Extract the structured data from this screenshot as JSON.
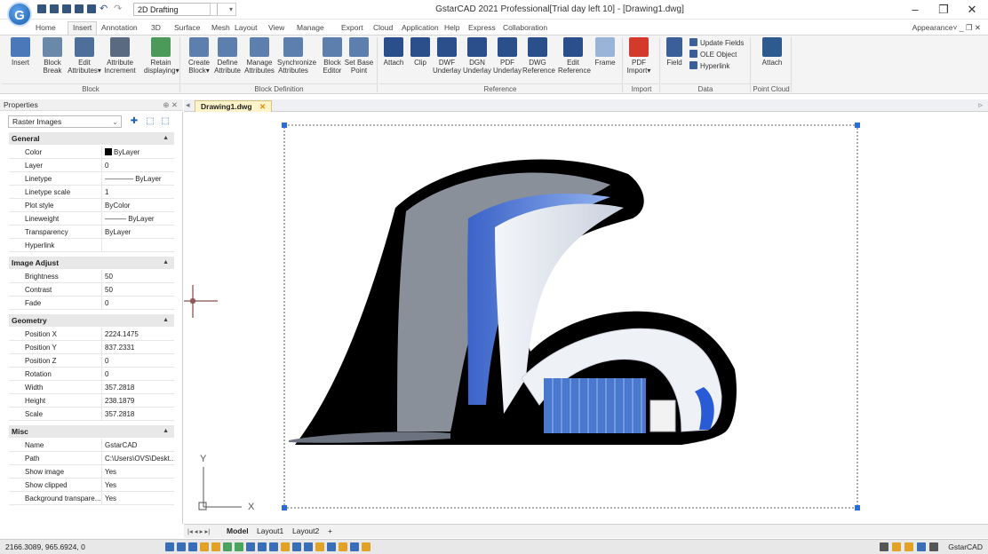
{
  "title_bar": {
    "logo": "G",
    "workspace": "2D Drafting",
    "window_title": "GstarCAD 2021 Professional[Trial day left 10] - [Drawing1.dwg]",
    "controls": [
      "–",
      "❐",
      "✕"
    ]
  },
  "tabs": [
    "Home",
    "Insert",
    "Annotation",
    "3D",
    "Surface",
    "Mesh",
    "Layout",
    "View",
    "Manage",
    "Export",
    "Cloud",
    "Application",
    "Help",
    "Express",
    "Collaboration"
  ],
  "active_tab": "Insert",
  "appearance": "Appearance˅  _ ❐ ✕",
  "ribbon": {
    "block": {
      "label": "Block",
      "buttons": [
        {
          "line1": "Insert",
          "line2": ""
        },
        {
          "line1": "Block",
          "line2": "Break"
        },
        {
          "line1": "Edit",
          "line2": "Attributes▾"
        },
        {
          "line1": "Attribute",
          "line2": "Increment"
        },
        {
          "line1": "Retain",
          "line2": "displaying▾"
        }
      ]
    },
    "block_definition": {
      "label": "Block Definition",
      "buttons": [
        {
          "line1": "Create",
          "line2": "Block▾"
        },
        {
          "line1": "Define",
          "line2": "Attribute"
        },
        {
          "line1": "Manage",
          "line2": "Attributes"
        },
        {
          "line1": "Synchronize",
          "line2": "Attributes"
        },
        {
          "line1": "Block",
          "line2": "Editor"
        },
        {
          "line1": "Set Base",
          "line2": "Point"
        }
      ]
    },
    "reference": {
      "label": "Reference",
      "buttons": [
        {
          "line1": "Attach",
          "line2": ""
        },
        {
          "line1": "Clip",
          "line2": ""
        },
        {
          "line1": "DWF",
          "line2": "Underlay"
        },
        {
          "line1": "DGN",
          "line2": "Underlay"
        },
        {
          "line1": "PDF",
          "line2": "Underlay"
        },
        {
          "line1": "DWG",
          "line2": "Reference"
        },
        {
          "line1": "Edit",
          "line2": "Reference"
        },
        {
          "line1": "Frame",
          "line2": ""
        }
      ]
    },
    "import": {
      "label": "Import",
      "button": {
        "line1": "PDF",
        "line2": "Import▾"
      }
    },
    "data": {
      "label": "Data",
      "field": "Field",
      "items": [
        "Update Fields",
        "OLE Object",
        "Hyperlink"
      ]
    },
    "point_cloud": {
      "label": "Point Cloud",
      "button": "Attach"
    }
  },
  "properties": {
    "title": "Properties",
    "pin": "⊕ ✕",
    "selector": "Raster Images",
    "sections": [
      {
        "name": "General",
        "rows": [
          {
            "k": "Color",
            "v": "ByLayer"
          },
          {
            "k": "Layer",
            "v": "0"
          },
          {
            "k": "Linetype",
            "v": "———— ByLayer"
          },
          {
            "k": "Linetype scale",
            "v": "1"
          },
          {
            "k": "Plot style",
            "v": "ByColor"
          },
          {
            "k": "Lineweight",
            "v": "——— ByLayer"
          },
          {
            "k": "Transparency",
            "v": "ByLayer"
          },
          {
            "k": "Hyperlink",
            "v": ""
          }
        ]
      },
      {
        "name": "Image Adjust",
        "rows": [
          {
            "k": "Brightness",
            "v": "50"
          },
          {
            "k": "Contrast",
            "v": "50"
          },
          {
            "k": "Fade",
            "v": "0"
          }
        ]
      },
      {
        "name": "Geometry",
        "rows": [
          {
            "k": "Position X",
            "v": "2224.1475"
          },
          {
            "k": "Position Y",
            "v": "837.2331"
          },
          {
            "k": "Position Z",
            "v": "0"
          },
          {
            "k": "Rotation",
            "v": "0"
          },
          {
            "k": "Width",
            "v": "357.2818"
          },
          {
            "k": "Height",
            "v": "238.1879"
          },
          {
            "k": "Scale",
            "v": "357.2818"
          }
        ]
      },
      {
        "name": "Misc",
        "rows": [
          {
            "k": "Name",
            "v": "GstarCAD"
          },
          {
            "k": "Path",
            "v": "C:\\Users\\OVS\\Deskt.."
          },
          {
            "k": "Show image",
            "v": "Yes"
          },
          {
            "k": "Show clipped",
            "v": "Yes"
          },
          {
            "k": "Background transpare...",
            "v": "Yes"
          }
        ]
      }
    ]
  },
  "document_tab": "Drawing1.dwg",
  "layout_tabs": [
    "Model",
    "Layout1",
    "Layout2",
    "+"
  ],
  "layout_nav": "|◂ ◂ ▸ ▸|",
  "ucs": {
    "x": "X",
    "y": "Y"
  },
  "status": {
    "coords": "2166.3089, 965.6924, 0",
    "app": "GstarCAD"
  },
  "colors": {
    "accent": "#1f5fb2",
    "doc_tab": "#fff3c9",
    "building_blue": "#2a5bd6"
  }
}
